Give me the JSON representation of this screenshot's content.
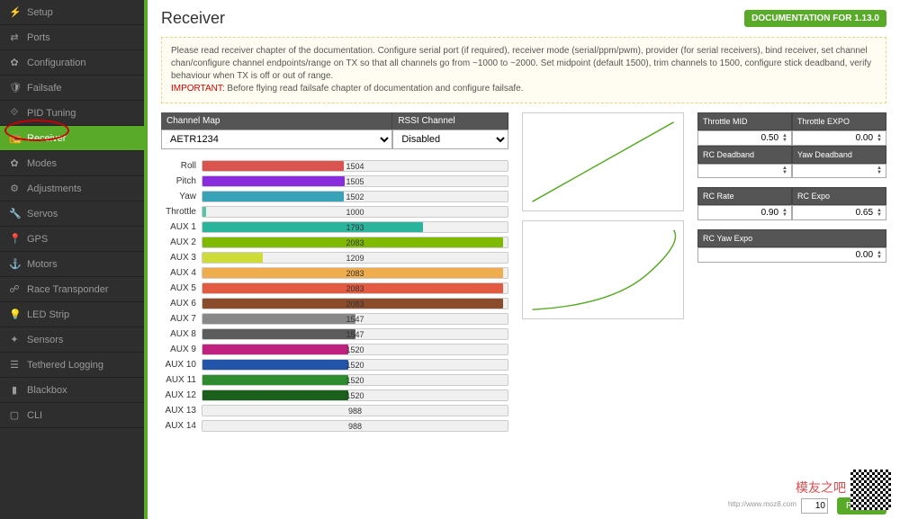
{
  "sidebar": {
    "items": [
      {
        "icon": "⚡",
        "label": "Setup"
      },
      {
        "icon": "⇄",
        "label": "Ports"
      },
      {
        "icon": "✿",
        "label": "Configuration"
      },
      {
        "icon": "🛡",
        "label": "Failsafe"
      },
      {
        "icon": "⟐",
        "label": "PID Tuning"
      },
      {
        "icon": "📻",
        "label": "Receiver",
        "active": true
      },
      {
        "icon": "✿",
        "label": "Modes"
      },
      {
        "icon": "⚙",
        "label": "Adjustments"
      },
      {
        "icon": "🔧",
        "label": "Servos"
      },
      {
        "icon": "📍",
        "label": "GPS"
      },
      {
        "icon": "⚓",
        "label": "Motors"
      },
      {
        "icon": "☍",
        "label": "Race Transponder"
      },
      {
        "icon": "💡",
        "label": "LED Strip"
      },
      {
        "icon": "✦",
        "label": "Sensors"
      },
      {
        "icon": "☰",
        "label": "Tethered Logging"
      },
      {
        "icon": "▮",
        "label": "Blackbox"
      },
      {
        "icon": "▢",
        "label": "CLI"
      }
    ]
  },
  "header": {
    "title": "Receiver",
    "doc_button": "DOCUMENTATION FOR 1.13.0"
  },
  "notice": {
    "text1": "Please read receiver chapter of the documentation. Configure serial port (if required), receiver mode (serial/ppm/pwm), provider (for serial receivers), bind receiver, set channel chan/configure channel endpoints/range on TX so that all channels go from ~1000 to ~2000. Set midpoint (default 1500), trim channels to 1500, configure stick deadband, verify behaviour when TX is off or out of range.",
    "important_label": "IMPORTANT:",
    "text2": "Before flying read failsafe chapter of documentation and configure failsafe."
  },
  "selectors": {
    "channel_map": {
      "label": "Channel Map",
      "value": "AETR1234"
    },
    "rssi": {
      "label": "RSSI Channel",
      "value": "Disabled"
    }
  },
  "channels": [
    {
      "name": "Roll",
      "value": 1504,
      "color": "#d9534f"
    },
    {
      "name": "Pitch",
      "value": 1505,
      "color": "#892cdc"
    },
    {
      "name": "Yaw",
      "value": 1502,
      "color": "#37a2b8"
    },
    {
      "name": "Throttle",
      "value": 1000,
      "color": "#56c5a3"
    },
    {
      "name": "AUX 1",
      "value": 1793,
      "color": "#2bb49c"
    },
    {
      "name": "AUX 2",
      "value": 2083,
      "color": "#7fba00"
    },
    {
      "name": "AUX 3",
      "value": 1209,
      "color": "#cddc39"
    },
    {
      "name": "AUX 4",
      "value": 2083,
      "color": "#f0ad4e"
    },
    {
      "name": "AUX 5",
      "value": 2083,
      "color": "#e25a3f"
    },
    {
      "name": "AUX 6",
      "value": 2083,
      "color": "#8b4c2b"
    },
    {
      "name": "AUX 7",
      "value": 1547,
      "color": "#888888"
    },
    {
      "name": "AUX 8",
      "value": 1547,
      "color": "#5c5c5c"
    },
    {
      "name": "AUX 9",
      "value": 1520,
      "color": "#c02080"
    },
    {
      "name": "AUX 10",
      "value": 1520,
      "color": "#2255aa"
    },
    {
      "name": "AUX 11",
      "value": 1520,
      "color": "#2e8b2e"
    },
    {
      "name": "AUX 12",
      "value": 1520,
      "color": "#1a5f1a"
    },
    {
      "name": "AUX 13",
      "value": 988,
      "color": "#2e8b2e"
    },
    {
      "name": "AUX 14",
      "value": 988,
      "color": "#2e8b2e"
    }
  ],
  "channel_range": {
    "min": 988,
    "max": 2100
  },
  "params": {
    "throttle_mid": {
      "label": "Throttle MID",
      "value": "0.50"
    },
    "throttle_expo": {
      "label": "Throttle EXPO",
      "value": "0.00"
    },
    "rc_deadband": {
      "label": "RC Deadband",
      "value": ""
    },
    "yaw_deadband": {
      "label": "Yaw Deadband",
      "value": ""
    },
    "rc_rate": {
      "label": "RC Rate",
      "value": "0.90"
    },
    "rc_expo": {
      "label": "RC Expo",
      "value": "0.65"
    },
    "rc_yaw_expo": {
      "label": "RC Yaw Expo",
      "value": "0.00"
    }
  },
  "footer": {
    "value": "10",
    "refresh": "Refresh"
  },
  "watermark": {
    "text": "模友之吧",
    "url": "http://www.moz8.com"
  }
}
